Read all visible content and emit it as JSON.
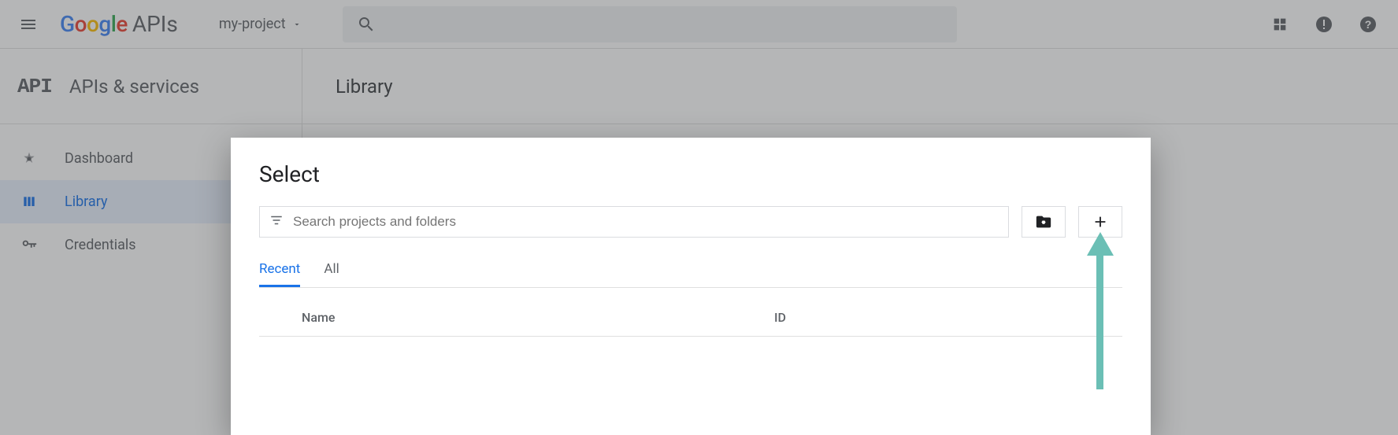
{
  "topbar": {
    "logo_text": "APIs",
    "logo_google": {
      "g1": "G",
      "o1": "o",
      "o2": "o",
      "g2": "g",
      "l": "l",
      "e": "e"
    },
    "project_label": "my-project"
  },
  "sidebar": {
    "section": "APIs & services",
    "items": [
      {
        "label": "Dashboard"
      },
      {
        "label": "Library"
      },
      {
        "label": "Credentials"
      }
    ]
  },
  "page": {
    "title": "Library"
  },
  "dialog": {
    "title": "Select",
    "search_placeholder": "Search projects and folders",
    "tabs": [
      {
        "label": "Recent",
        "active": true
      },
      {
        "label": "All",
        "active": false
      }
    ],
    "columns": {
      "name": "Name",
      "id": "ID"
    }
  }
}
